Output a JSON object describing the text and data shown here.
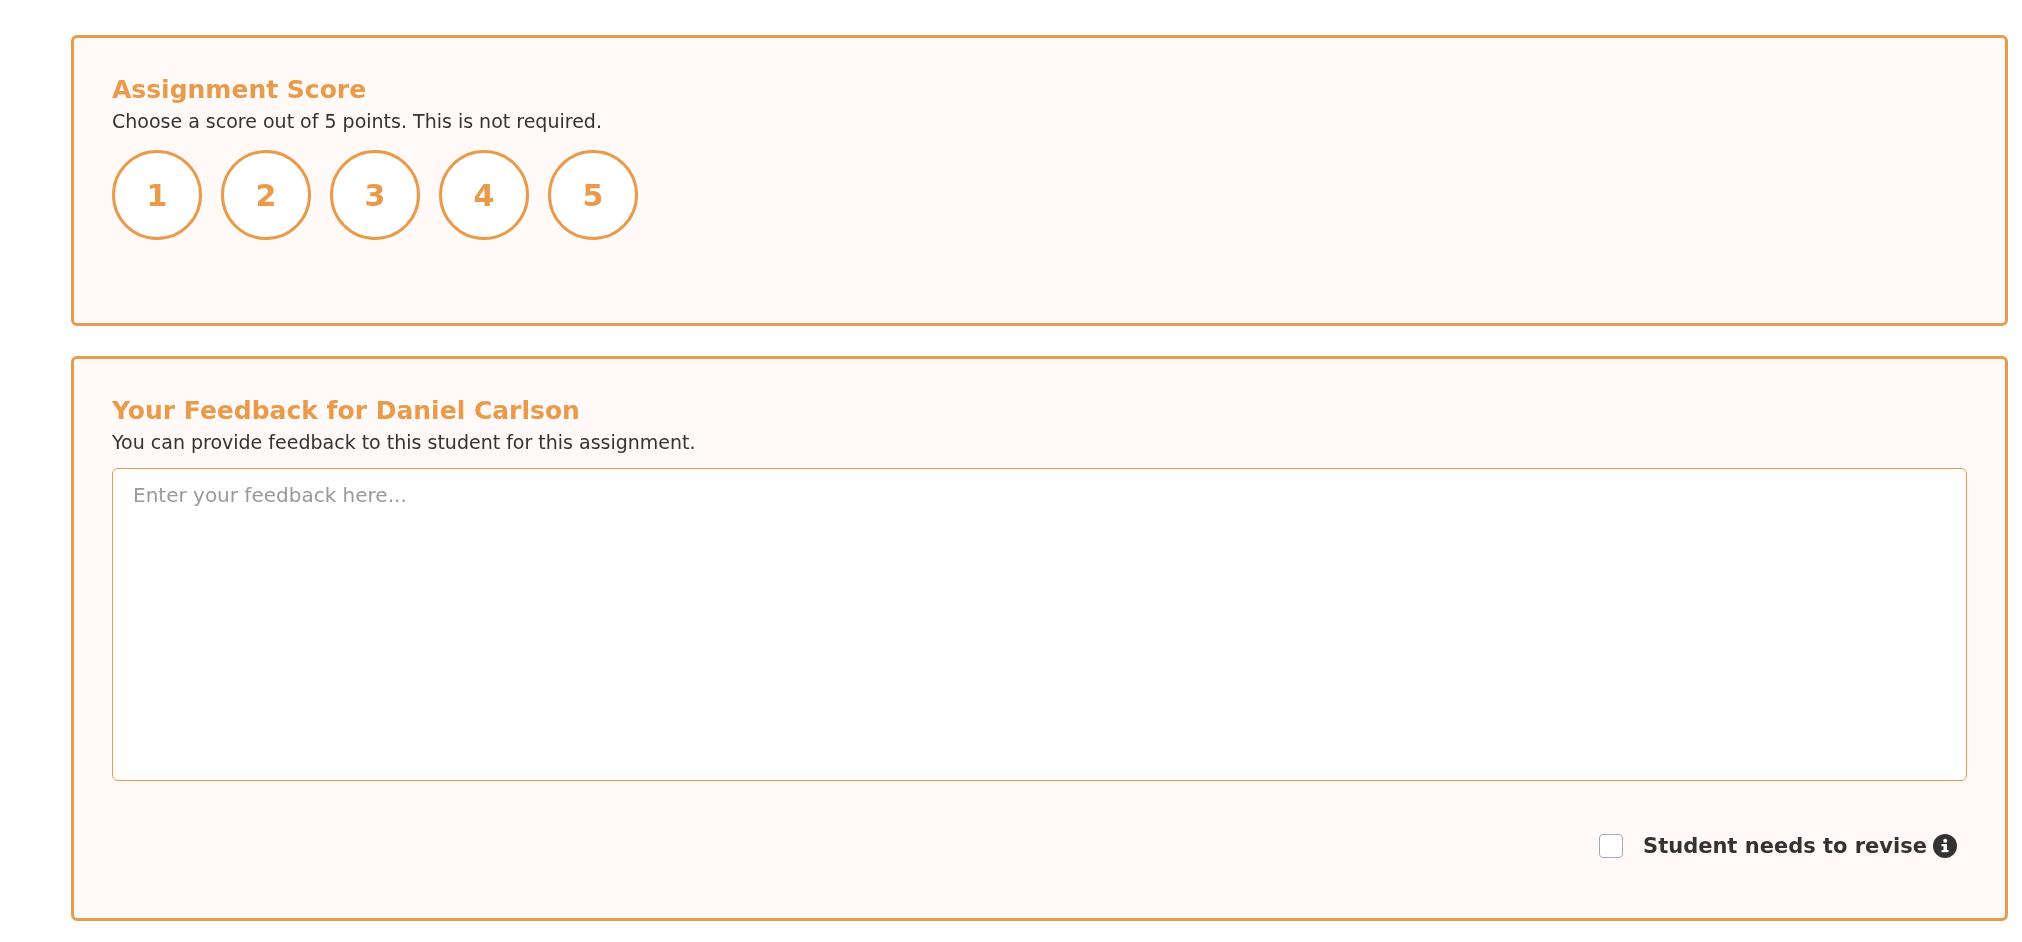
{
  "score_card": {
    "title": "Assignment Score",
    "description": "Choose a score out of 5 points. This is not required.",
    "options": [
      {
        "label": "1",
        "selected": false
      },
      {
        "label": "2",
        "selected": false
      },
      {
        "label": "3",
        "selected": false
      },
      {
        "label": "4",
        "selected": false
      },
      {
        "label": "5",
        "selected": false
      }
    ]
  },
  "feedback_card": {
    "title": "Your Feedback for Daniel Carlson",
    "description": "You can provide feedback to this student for this assignment.",
    "feedback_field": {
      "placeholder": "Enter your feedback here..."
    },
    "revise_checkbox": {
      "label": "Student needs to revise",
      "checked": false
    }
  }
}
